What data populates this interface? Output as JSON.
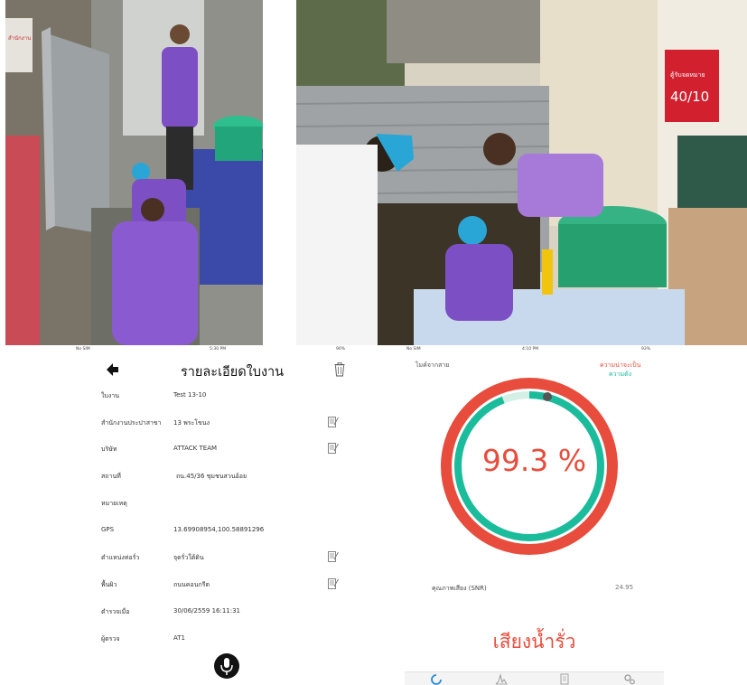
{
  "colors": {
    "accent_red": "#e74c3c",
    "accent_green": "#1abc9c",
    "photo_purple": "#7d4fc4"
  },
  "photo_left": {
    "sign_text": "สำนักงาน"
  },
  "photo_right": {
    "mailbox_label": "ตู้รับจดหมาย",
    "mailbox_number": "40/10"
  },
  "detail_screen": {
    "status_bar": {
      "carrier": "No SIM",
      "time": "5:30 PM",
      "battery": "90%"
    },
    "title": "รายละเอียดใบงาน",
    "back_icon": "back-arrow-icon",
    "delete_icon": "trash-icon",
    "rows": [
      {
        "label": "ใบงาน",
        "value": "Test 13-10",
        "editable": false
      },
      {
        "label": "สำนักงานประปาสาขา",
        "value": "13 พระโขนง",
        "editable": true
      },
      {
        "label": "บริษัท",
        "value": "ATTACK TEAM",
        "editable": true
      },
      {
        "label": "สถานที่",
        "value": "ถน.45/36 ชุมชนสวนอ้อย",
        "editable": false
      },
      {
        "label": "หมายเหตุ",
        "value": "",
        "editable": false
      },
      {
        "label": "GPS",
        "value": "13.69908954,100.58891296",
        "editable": false
      },
      {
        "label": "ตำแหน่งท่อรั่ว",
        "value": "จุดรั่วใต้ดิน",
        "editable": true
      },
      {
        "label": "พื้นผิว",
        "value": "ถนนคอนกรีต",
        "editable": true
      },
      {
        "label": "ตำรวจเมื่อ",
        "value": "30/06/2559 16:11:31",
        "editable": false
      },
      {
        "label": "ผู้ตรวจ",
        "value": "AT1",
        "editable": false
      }
    ],
    "mic_icon": "microphone-icon"
  },
  "analysis_screen": {
    "status_bar": {
      "carrier": "No SIM",
      "time": "4:10 PM",
      "battery": "93%"
    },
    "source_label": "ไมค์จากสาย",
    "legend_probability": "ความน่าจะเป็น",
    "legend_loudness": "ความดัง",
    "gauge_value": "99.3 %",
    "probability_percent": 99.3,
    "snr_label": "คุณภาพเสียง (SNR)",
    "snr_value": "24.95",
    "result_text": "เสียงน้ำรั่ว",
    "tabs": [
      "gauge-tab-icon",
      "spectrum-tab-icon",
      "document-tab-icon",
      "settings-tab-icon"
    ]
  }
}
